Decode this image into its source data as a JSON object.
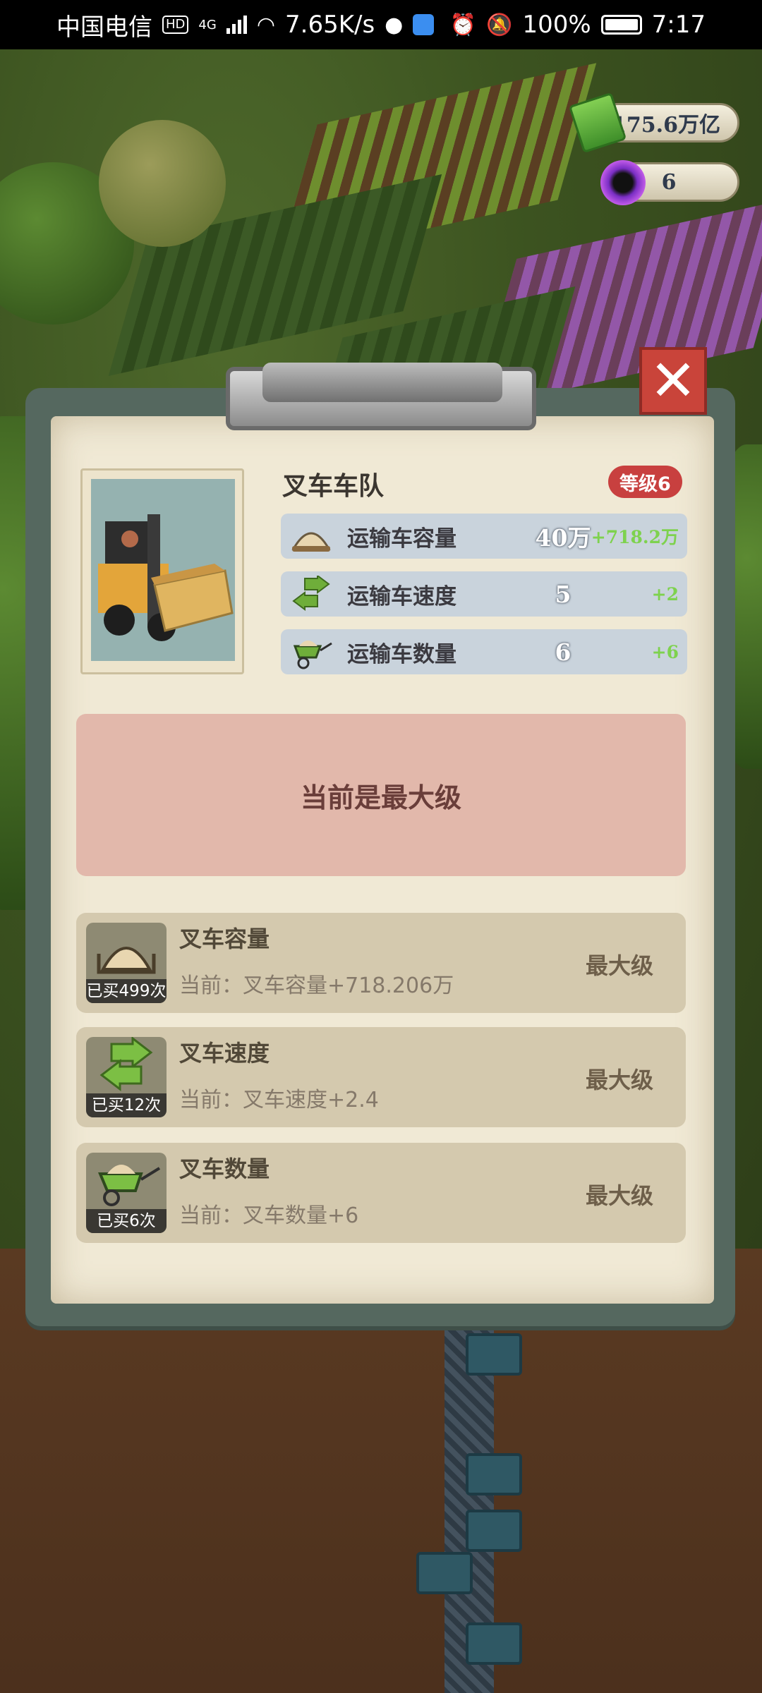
{
  "status_bar": {
    "carrier": "中国电信",
    "hd_badge": "HD",
    "network": "4G",
    "speed": "7.65K/s",
    "battery": "100%",
    "time": "7:17"
  },
  "resources": {
    "money": "175.6万亿",
    "orb": "6"
  },
  "dialog": {
    "title": "叉车车队",
    "level": "等级6",
    "close_icon": "close-x-icon",
    "stats": [
      {
        "icon": "sand-pile-icon",
        "label": "运输车容量",
        "value": "40万",
        "bonus": "+718.2万"
      },
      {
        "icon": "arrows-icon",
        "label": "运输车速度",
        "value": "5",
        "bonus": "+2"
      },
      {
        "icon": "wheelbarrow-icon",
        "label": "运输车数量",
        "value": "6",
        "bonus": "+6"
      }
    ],
    "max_message": "当前是最大级",
    "upgrades": [
      {
        "icon": "sand-pile-icon",
        "bought": "已买499次",
        "name": "叉车容量",
        "current": "当前：叉车容量+718.206万",
        "status": "最大级"
      },
      {
        "icon": "arrows-icon",
        "bought": "已买12次",
        "name": "叉车速度",
        "current": "当前：叉车速度+2.4",
        "status": "最大级"
      },
      {
        "icon": "wheelbarrow-icon",
        "bought": "已买6次",
        "name": "叉车数量",
        "current": "当前：叉车数量+6",
        "status": "最大级"
      }
    ]
  },
  "colors": {
    "level_badge": "#c8403f",
    "bonus_green": "#7ed24e",
    "max_box": "#e2b8ab",
    "close_button": "#c9443a"
  }
}
